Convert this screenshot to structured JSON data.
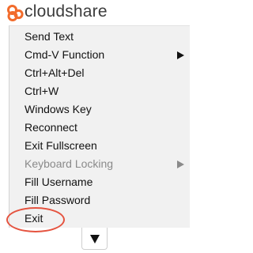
{
  "brand": {
    "name": "cloudshare",
    "accent_color": "#f26b2b",
    "logo_icon": "cloudshare-logo-icon"
  },
  "menu": {
    "items": [
      {
        "label": "Send Text",
        "enabled": true,
        "has_submenu": false
      },
      {
        "label": "Cmd-V Function",
        "enabled": true,
        "has_submenu": true
      },
      {
        "label": "Ctrl+Alt+Del",
        "enabled": true,
        "has_submenu": false
      },
      {
        "label": "Ctrl+W",
        "enabled": true,
        "has_submenu": false
      },
      {
        "label": "Windows Key",
        "enabled": true,
        "has_submenu": false
      },
      {
        "label": "Reconnect",
        "enabled": true,
        "has_submenu": false
      },
      {
        "label": "Exit Fullscreen",
        "enabled": true,
        "has_submenu": false
      },
      {
        "label": "Keyboard Locking",
        "enabled": false,
        "has_submenu": true
      },
      {
        "label": "Fill Username",
        "enabled": true,
        "has_submenu": false
      },
      {
        "label": "Fill Password",
        "enabled": true,
        "has_submenu": false
      },
      {
        "label": "Exit",
        "enabled": true,
        "has_submenu": false
      }
    ],
    "highlighted_item": "Exit",
    "highlight_color": "#e5533f"
  },
  "toggle_button": {
    "icon": "triangle-down-icon"
  }
}
